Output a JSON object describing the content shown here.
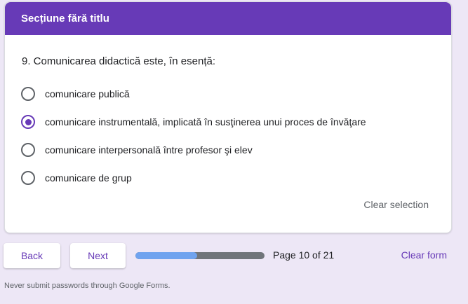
{
  "section": {
    "title": "Secțiune fără titlu"
  },
  "question": {
    "text": "9. Comunicarea didactică este, în esență:",
    "options": [
      {
        "label": "comunicare publică",
        "selected": false
      },
      {
        "label": "comunicare instrumentală, implicată în susţinerea unui proces de învăţare",
        "selected": true
      },
      {
        "label": "comunicare interpersonală între profesor şi elev",
        "selected": false
      },
      {
        "label": "comunicare de grup",
        "selected": false
      }
    ],
    "clear_selection": "Clear selection"
  },
  "nav": {
    "back_label": "Back",
    "next_label": "Next",
    "progress": 0.48,
    "page_text": "Page 10 of 21",
    "clear_form": "Clear form"
  },
  "footer": {
    "note": "Never submit passwords through Google Forms."
  },
  "colors": {
    "accent": "#673ab7",
    "background": "#ede7f6",
    "progress_fill": "#6fa3ef",
    "progress_track": "#70757a"
  }
}
